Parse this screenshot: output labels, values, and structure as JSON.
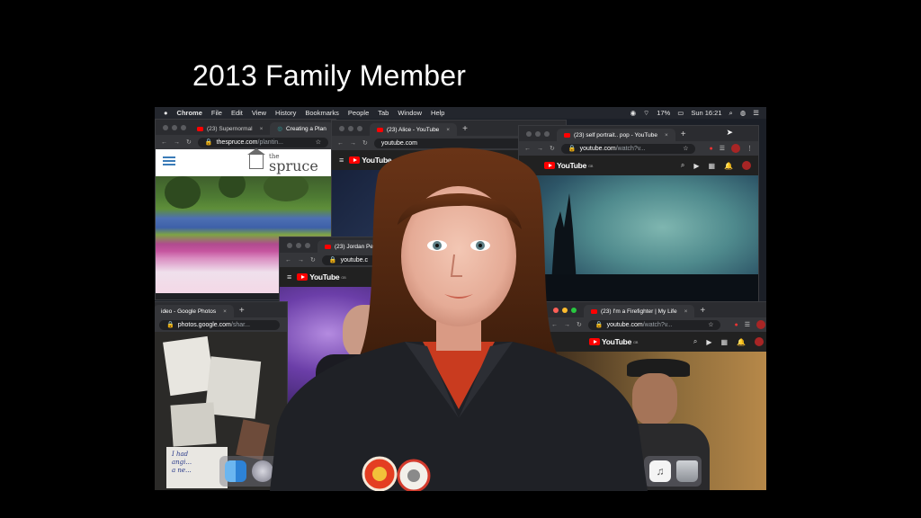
{
  "headline": "2013 Family Member",
  "menubar": {
    "apple": "",
    "items": [
      "Chrome",
      "File",
      "Edit",
      "View",
      "History",
      "Bookmarks",
      "People",
      "Tab",
      "Window",
      "Help"
    ],
    "battery": "17%",
    "clock": "Sun 16:21"
  },
  "windows": {
    "spruce": {
      "tab1": "(23) Supernormal",
      "tab2": "Creating a Plan",
      "url_host": "thespruce.com",
      "url_path": "/plantin...",
      "logo_the": "the",
      "logo_name": "spruce"
    },
    "alice": {
      "tab": "(23) Alice - YouTube",
      "url_host": "youtube.com",
      "yt_logo": "YouTube",
      "region": "GB"
    },
    "self_portrait": {
      "tab": "(23) self portrait.. pop - YouTube",
      "url_host": "youtube.com",
      "url_path": "/watch?v...",
      "yt_logo": "YouTube",
      "region": "GB",
      "notif": "9+"
    },
    "jordan": {
      "tab": "(23) Jordan Pet",
      "url_host": "youtube.c",
      "yt_logo": "YouTube",
      "region": "GB"
    },
    "photos": {
      "tab": "ideo - Google Photos",
      "url_host": "photos.google.com",
      "url_path": "/shar..."
    },
    "firefighter": {
      "tab": "(23) I'm a Firefighter | My Life",
      "url_host": "youtube.com",
      "url_path": "/watch?v...",
      "yt_logo": "YouTube",
      "region": "GB",
      "notif": "9+"
    }
  },
  "handwriting": [
    "I had",
    "angi...",
    "a ne..."
  ],
  "icons": {
    "new_tab": "+",
    "close": "×",
    "back": "←",
    "forward": "→",
    "reload": "↻",
    "star": "☆",
    "menu": "⋮",
    "hamburger": "≡"
  }
}
